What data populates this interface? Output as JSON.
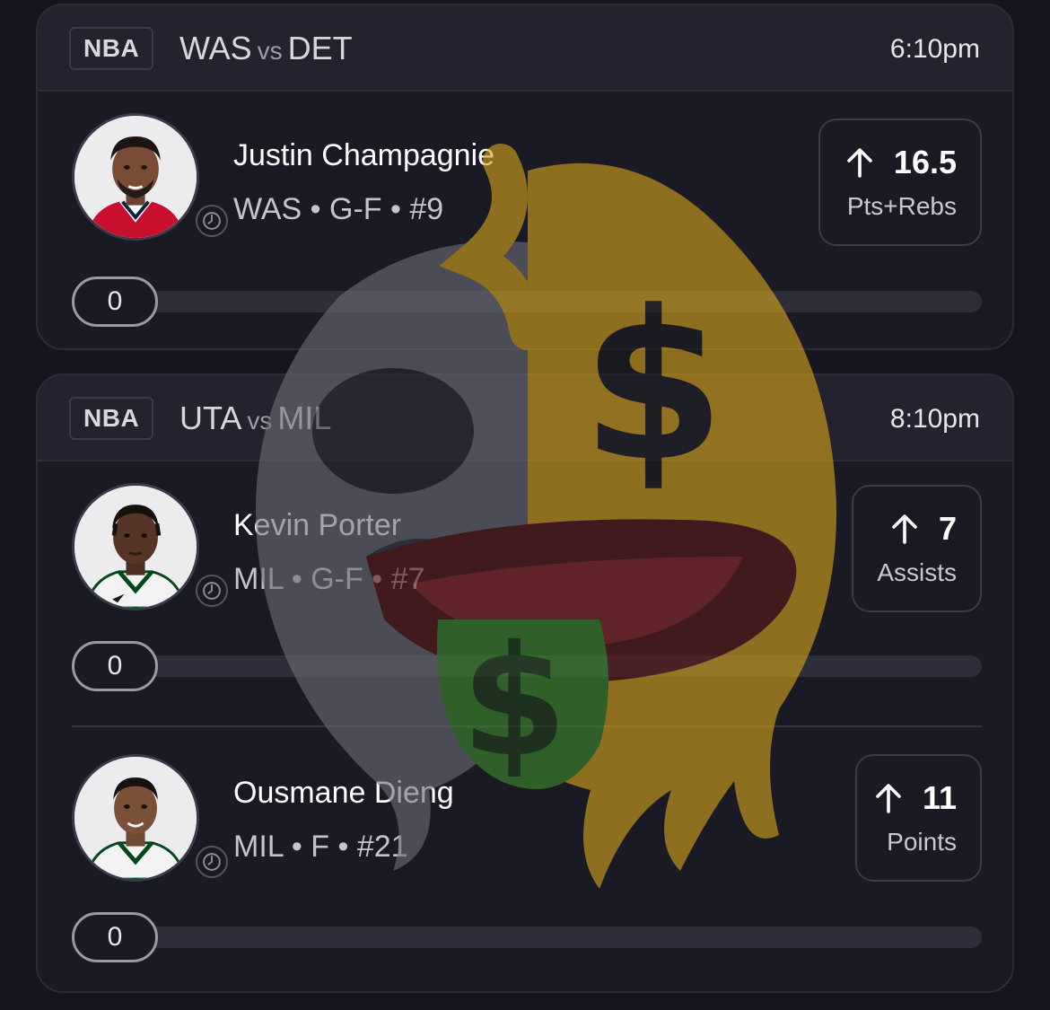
{
  "games": [
    {
      "league": "NBA",
      "team_a": "WAS",
      "vs": "vs",
      "team_b": "DET",
      "time": "6:10pm",
      "players": [
        {
          "name": "Justin Champagnie",
          "team": "WAS",
          "position": "G-F",
          "number": "#9",
          "line": "16.5",
          "stat": "Pts+Rebs",
          "progress": "0",
          "jersey_color": "#c8102e"
        }
      ]
    },
    {
      "league": "NBA",
      "team_a": "UTA",
      "vs": "vs",
      "team_b": "MIL",
      "time": "8:10pm",
      "players": [
        {
          "name": "Kevin Porter",
          "team": "MIL",
          "position": "G-F",
          "number": "#7",
          "line": "7",
          "stat": "Assists",
          "progress": "0",
          "jersey_color": "#f2f2f2"
        },
        {
          "name": "Ousmane Dieng",
          "team": "MIL",
          "position": "F",
          "number": "#21",
          "line": "11",
          "stat": "Points",
          "progress": "0",
          "jersey_color": "#f2f2f2"
        }
      ]
    }
  ],
  "meta_separator": "•",
  "icons": {
    "direction": "arrow-up-icon",
    "status": "clock-icon",
    "watermark": "melting-money-face-logo"
  },
  "colors": {
    "background": "#15151f",
    "card": "#1a1a25",
    "header": "#232330",
    "track": "#2e2e3a",
    "bucks_green": "#00471b"
  }
}
